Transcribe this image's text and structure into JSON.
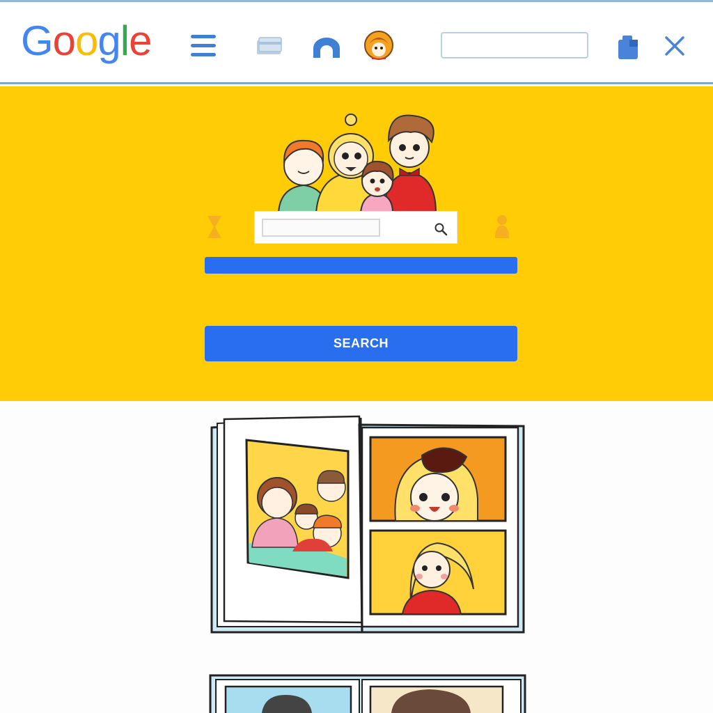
{
  "header": {
    "logo": {
      "letters": [
        "G",
        "o",
        "o",
        "g",
        "l",
        "e"
      ],
      "colors": [
        "#4285f4",
        "#ea4335",
        "#fbbc05",
        "#4285f4",
        "#34a853",
        "#ea4335"
      ]
    },
    "search_value": "",
    "icons": [
      "menu-icon",
      "card-icon",
      "arch-icon",
      "avatar-icon",
      "bag-icon",
      "close-icon"
    ]
  },
  "hero": {
    "search_value": "",
    "bar_button_label": "",
    "search_button_label": "SEARCH"
  },
  "colors": {
    "hero_yellow": "#ffcc05",
    "button_blue": "#2a6ef0",
    "header_border": "#7fa7c8"
  }
}
